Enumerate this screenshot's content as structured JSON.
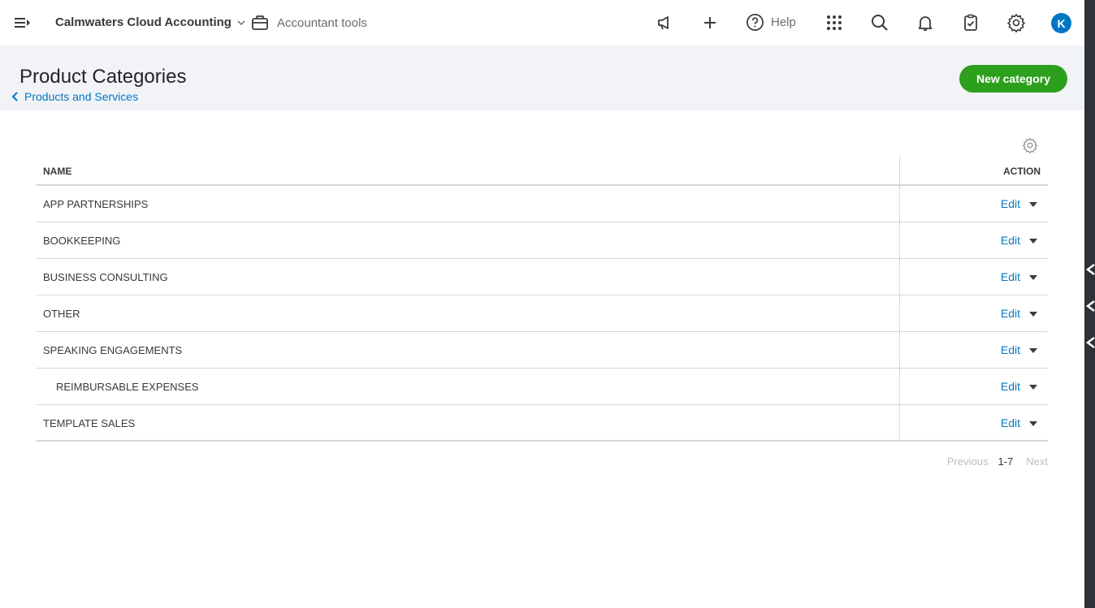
{
  "topbar": {
    "company_name": "Calmwaters Cloud Accounting",
    "accountant_tools_label": "Accountant tools",
    "help_label": "Help",
    "avatar_initial": "K"
  },
  "header": {
    "title": "Product Categories",
    "breadcrumb": "Products and Services",
    "new_button": "New category"
  },
  "table": {
    "col_name": "NAME",
    "col_action": "ACTION",
    "rows": [
      {
        "name": "APP PARTNERSHIPS",
        "action": "Edit"
      },
      {
        "name": "BOOKKEEPING",
        "action": "Edit"
      },
      {
        "name": "BUSINESS CONSULTING",
        "action": "Edit"
      },
      {
        "name": "OTHER",
        "action": "Edit"
      },
      {
        "name": "SPEAKING ENGAGEMENTS",
        "action": "Edit"
      },
      {
        "name": "REIMBURSABLE EXPENSES",
        "action": "Edit"
      },
      {
        "name": "TEMPLATE SALES",
        "action": "Edit"
      }
    ]
  },
  "pagination": {
    "previous": "Previous",
    "range": "1-7",
    "next": "Next"
  },
  "colors": {
    "accent": "#0077c5",
    "primary_button": "#2ca01c",
    "header_band": "#f2f3f7"
  }
}
